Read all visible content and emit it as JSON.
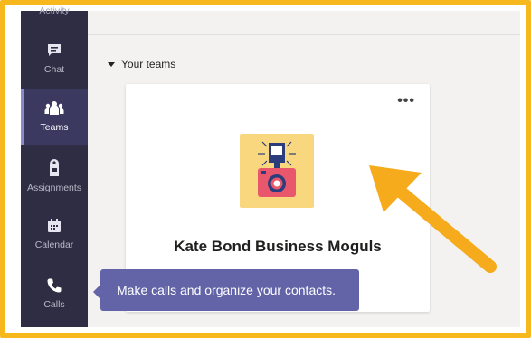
{
  "rail": {
    "top_partial_label": "Activity",
    "items": [
      {
        "label": "Chat",
        "icon": "chat-icon"
      },
      {
        "label": "Teams",
        "icon": "teams-icon",
        "active": true
      },
      {
        "label": "Assignments",
        "icon": "assignments-icon"
      },
      {
        "label": "Calendar",
        "icon": "calendar-icon"
      },
      {
        "label": "Calls",
        "icon": "phone-icon"
      }
    ]
  },
  "main": {
    "section_title": "Your teams",
    "team_card": {
      "more_label": "•••",
      "name": "Kate Bond Business Moguls",
      "icon": "camera-icon"
    }
  },
  "tooltip": {
    "text": "Make calls and organize your contacts."
  },
  "colors": {
    "highlight_border": "#f6b81c",
    "rail_bg": "#2f2d43",
    "accent": "#6264a7",
    "arrow": "#f5ab1b"
  }
}
